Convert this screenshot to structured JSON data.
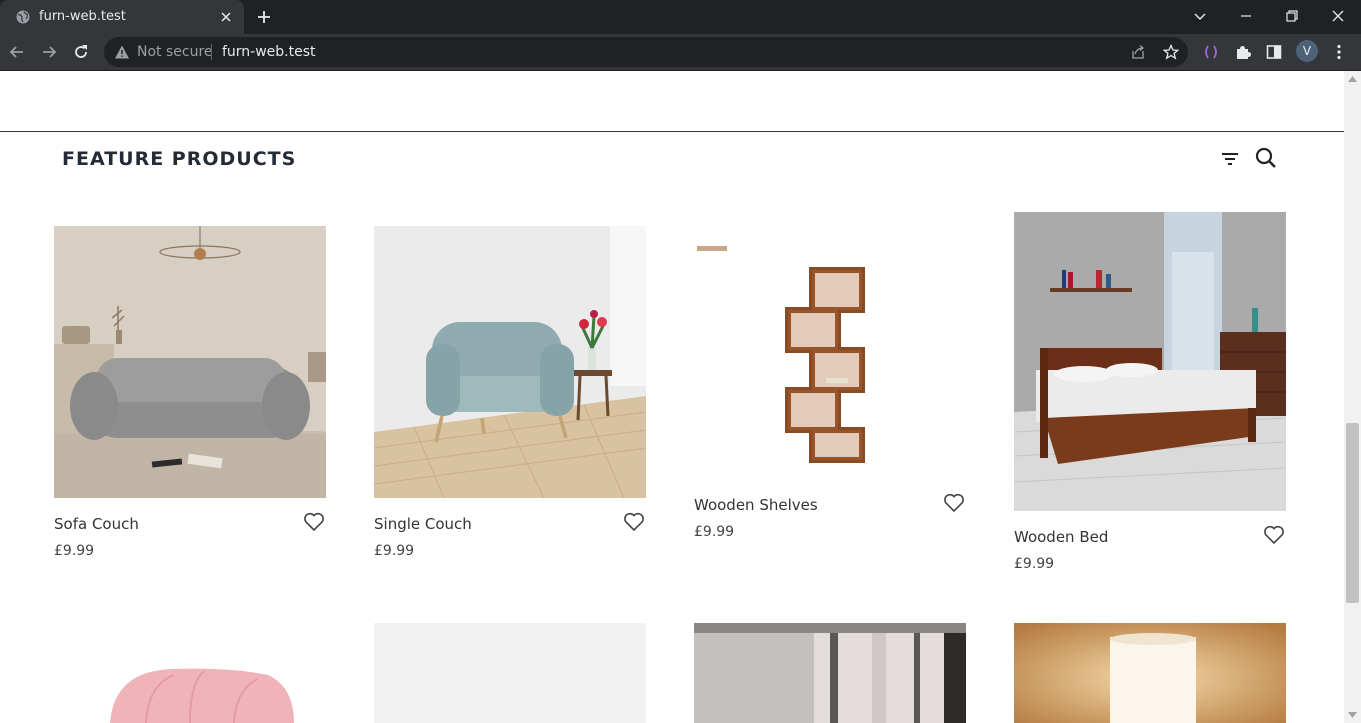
{
  "browser": {
    "tab_title": "furn-web.test",
    "security_label": "Not secure",
    "url": "furn-web.test",
    "profile_initial": "V"
  },
  "section": {
    "title": "FEATURE PRODUCTS"
  },
  "products": [
    {
      "name": "Sofa Couch",
      "price": "£9.99"
    },
    {
      "name": "Single Couch",
      "price": "£9.99"
    },
    {
      "name": "Wooden Shelves",
      "price": "£9.99"
    },
    {
      "name": "Wooden Bed",
      "price": "£9.99"
    }
  ],
  "colors": {
    "chrome_dark": "#202124",
    "chrome_tab": "#35363a",
    "title_text": "#222b36"
  }
}
